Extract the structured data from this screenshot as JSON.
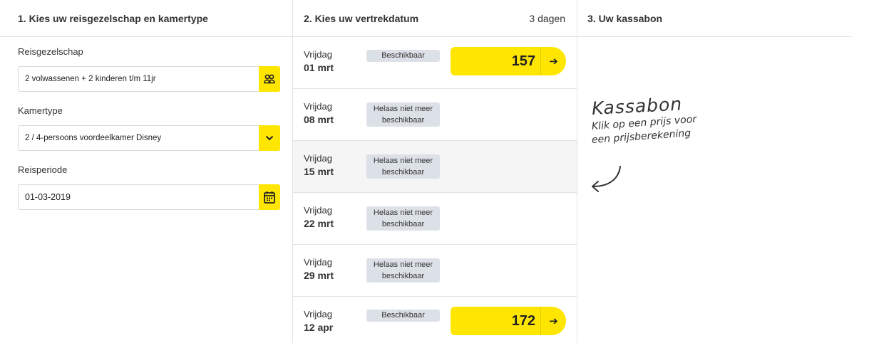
{
  "col1": {
    "header": "1. Kies uw reisgezelschap en kamertype",
    "party": {
      "label": "Reisgezelschap",
      "value": "2 volwassenen + 2 kinderen t/m 11jr",
      "icon": "people-icon"
    },
    "room": {
      "label": "Kamertype",
      "value": "2 / 4-persoons voordeelkamer Disney",
      "icon": "chevron-down-icon"
    },
    "period": {
      "label": "Reisperiode",
      "value": "01-03-2019",
      "icon": "calendar-icon"
    }
  },
  "col2": {
    "header": "2. Kies uw vertrekdatum",
    "duration": "3 dagen",
    "rows": [
      {
        "day": "Vrijdag",
        "date": "01 mrt",
        "badge": "Beschikbaar",
        "badge_line2": "",
        "price": "157",
        "available": true
      },
      {
        "day": "Vrijdag",
        "date": "08 mrt",
        "badge": "Helaas niet meer",
        "badge_line2": "beschikbaar",
        "price": "",
        "available": false
      },
      {
        "day": "Vrijdag",
        "date": "15 mrt",
        "badge": "Helaas niet meer",
        "badge_line2": "beschikbaar",
        "price": "",
        "available": false
      },
      {
        "day": "Vrijdag",
        "date": "22 mrt",
        "badge": "Helaas niet meer",
        "badge_line2": "beschikbaar",
        "price": "",
        "available": false
      },
      {
        "day": "Vrijdag",
        "date": "29 mrt",
        "badge": "Helaas niet meer",
        "badge_line2": "beschikbaar",
        "price": "",
        "available": false
      },
      {
        "day": "Vrijdag",
        "date": "12 apr",
        "badge": "Beschikbaar",
        "badge_line2": "",
        "price": "172",
        "available": true
      }
    ]
  },
  "col3": {
    "header": "3. Uw kassabon",
    "note_title": "Kassabon",
    "note_line1": "Klik op een prijs voor",
    "note_line2": "een prijsberekening"
  },
  "colors": {
    "accent": "#ffe600",
    "badge_bg": "#dce0e7",
    "border": "#e3e3e3"
  }
}
